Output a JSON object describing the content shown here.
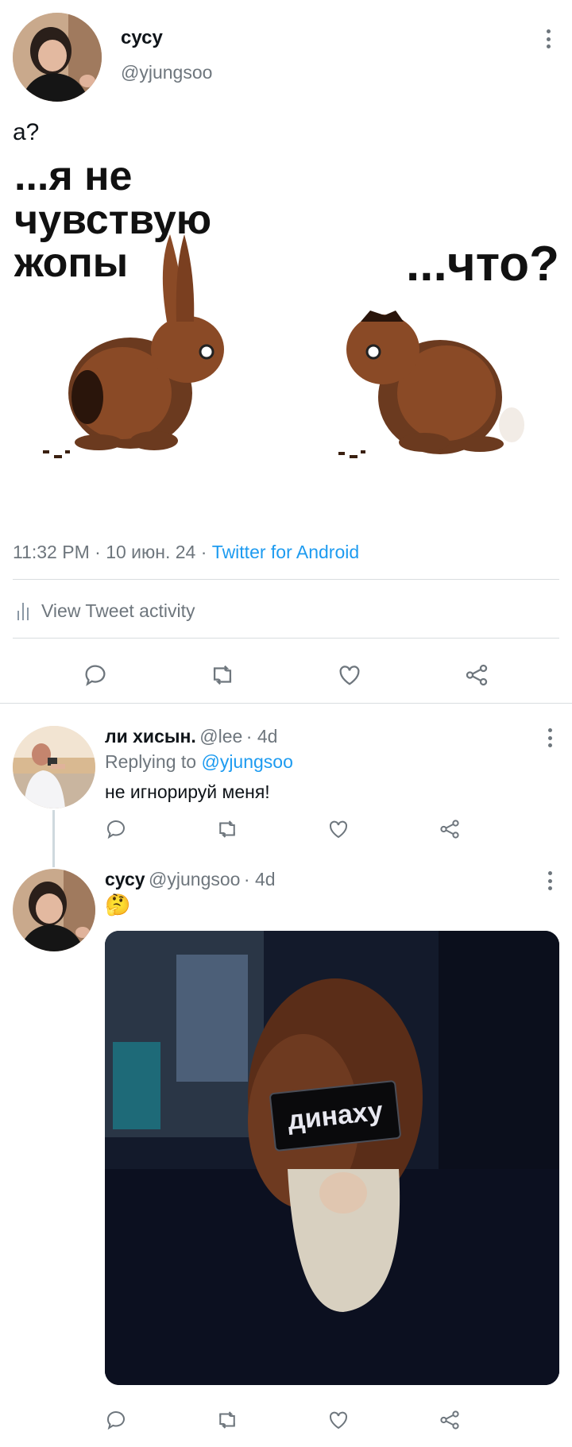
{
  "main_tweet": {
    "display_name": "сусу",
    "handle": "@yjungsoo",
    "text": "а?",
    "meme": {
      "left_caption": [
        "...я не",
        "чувствую",
        "жопы"
      ],
      "right_caption": "...что?"
    },
    "time": "11:32 PM",
    "date": "10 июн. 24",
    "source": "Twitter for Android",
    "activity_label": "View Tweet activity",
    "actions": [
      "reply-icon",
      "retweet-icon",
      "like-icon",
      "share-icon"
    ]
  },
  "replies": [
    {
      "display_name": "ли хисын.",
      "handle": "@lee",
      "age": "4d",
      "replying_prefix": "Replying to",
      "replying_to": "@yjungsoo",
      "text": "не игнорируй меня!"
    },
    {
      "display_name": "сусу",
      "handle": "@yjungsoo",
      "age": "4d",
      "text": "🤔",
      "image_caption": "динаху"
    }
  ],
  "colors": {
    "accent": "#1d9bf0",
    "muted": "#6e767d",
    "text": "#0f1419",
    "divider": "#d9dde0"
  }
}
